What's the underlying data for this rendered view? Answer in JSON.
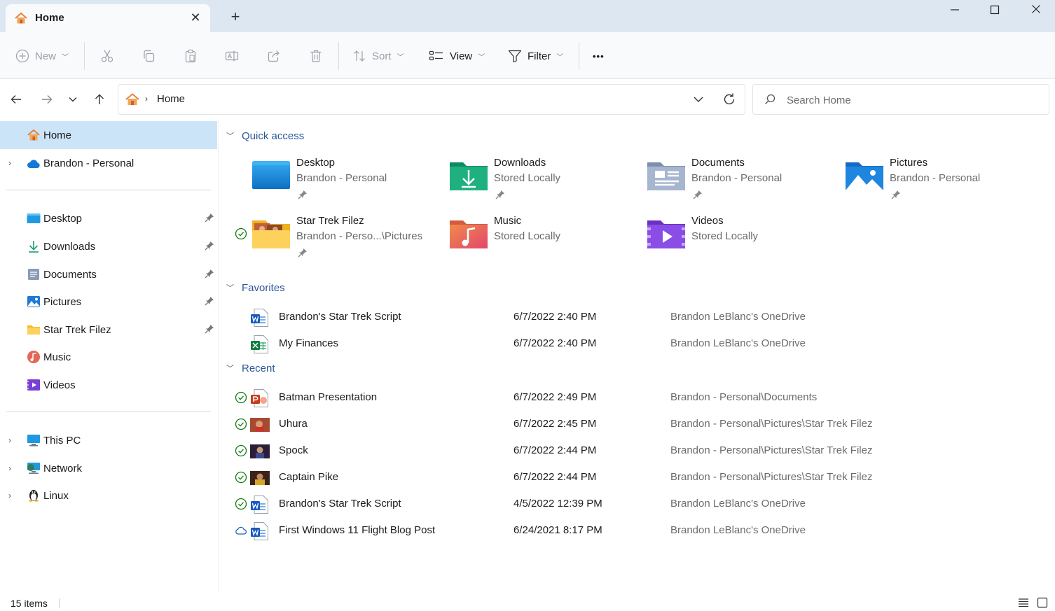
{
  "window": {
    "tab_title": "Home",
    "new_tab_symbol": "+",
    "close_tab_symbol": "✕"
  },
  "commandbar": {
    "new_label": "New",
    "sort_label": "Sort",
    "view_label": "View",
    "filter_label": "Filter",
    "more_label": "•••"
  },
  "address": {
    "breadcrumb": "Home",
    "search_placeholder": "Search Home"
  },
  "sidebar": {
    "top_items": [
      {
        "label": "Home",
        "icon": "home-icon",
        "selected": true
      },
      {
        "label": "Brandon - Personal",
        "icon": "onedrive-cloud-icon",
        "expandable": true
      }
    ],
    "pinned_items": [
      {
        "label": "Desktop",
        "icon": "desktop-folder-icon"
      },
      {
        "label": "Downloads",
        "icon": "downloads-icon"
      },
      {
        "label": "Documents",
        "icon": "documents-icon"
      },
      {
        "label": "Pictures",
        "icon": "pictures-icon"
      },
      {
        "label": "Star Trek Filez",
        "icon": "folder-icon"
      },
      {
        "label": "Music",
        "icon": "music-icon"
      },
      {
        "label": "Videos",
        "icon": "videos-icon"
      }
    ],
    "bottom_items": [
      {
        "label": "This PC",
        "icon": "this-pc-icon"
      },
      {
        "label": "Network",
        "icon": "network-icon"
      },
      {
        "label": "Linux",
        "icon": "linux-penguin-icon"
      }
    ]
  },
  "sections": {
    "quick_access": "Quick access",
    "favorites": "Favorites",
    "recent": "Recent"
  },
  "quick_access": [
    {
      "name": "Desktop",
      "sub": "Brandon - Personal",
      "pinned": true,
      "icon": "desktop-folder-icon"
    },
    {
      "name": "Downloads",
      "sub": "Stored Locally",
      "pinned": true,
      "icon": "downloads-folder-icon"
    },
    {
      "name": "Documents",
      "sub": "Brandon - Personal",
      "pinned": true,
      "icon": "documents-folder-icon"
    },
    {
      "name": "Pictures",
      "sub": "Brandon - Personal",
      "pinned": true,
      "icon": "pictures-folder-icon"
    },
    {
      "name": "Star Trek Filez",
      "sub": "Brandon - Perso...\\Pictures",
      "pinned": true,
      "synced": true,
      "icon": "folder-with-images-icon"
    },
    {
      "name": "Music",
      "sub": "Stored Locally",
      "pinned": false,
      "icon": "music-folder-icon"
    },
    {
      "name": "Videos",
      "sub": "Stored Locally",
      "pinned": false,
      "icon": "videos-folder-icon"
    }
  ],
  "favorites": [
    {
      "name": "Brandon's Star Trek Script",
      "date": "6/7/2022 2:40 PM",
      "location": "Brandon LeBlanc's OneDrive",
      "type": "word"
    },
    {
      "name": "My Finances",
      "date": "6/7/2022 2:40 PM",
      "location": "Brandon LeBlanc's OneDrive",
      "type": "excel"
    }
  ],
  "recent": [
    {
      "name": "Batman Presentation",
      "date": "6/7/2022 2:49 PM",
      "location": "Brandon - Personal\\Documents",
      "type": "powerpoint",
      "status": "synced"
    },
    {
      "name": "Uhura",
      "date": "6/7/2022 2:45 PM",
      "location": "Brandon - Personal\\Pictures\\Star Trek Filez",
      "type": "image",
      "status": "synced"
    },
    {
      "name": "Spock",
      "date": "6/7/2022 2:44 PM",
      "location": "Brandon - Personal\\Pictures\\Star Trek Filez",
      "type": "image",
      "status": "synced"
    },
    {
      "name": "Captain Pike",
      "date": "6/7/2022 2:44 PM",
      "location": "Brandon - Personal\\Pictures\\Star Trek Filez",
      "type": "image",
      "status": "synced"
    },
    {
      "name": "Brandon's Star Trek Script",
      "date": "4/5/2022 12:39 PM",
      "location": "Brandon LeBlanc's OneDrive",
      "type": "word",
      "status": "synced"
    },
    {
      "name": "First Windows 11 Flight Blog Post",
      "date": "6/24/2021 8:17 PM",
      "location": "Brandon LeBlanc's OneDrive",
      "type": "word",
      "status": "cloud"
    }
  ],
  "statusbar": {
    "item_count": "15 items"
  },
  "colors": {
    "accent": "#0067c0",
    "selected_bg": "#cce4f7",
    "section_text": "#2b5797",
    "titlebar_bg": "#dde7f1",
    "sync_green": "#107c10"
  }
}
